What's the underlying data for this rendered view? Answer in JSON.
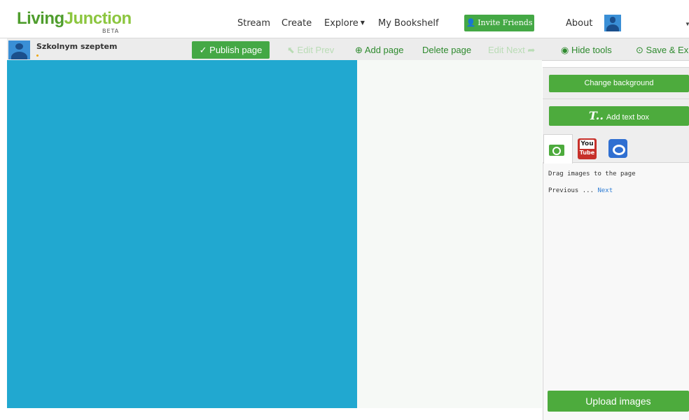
{
  "brand": {
    "name_part1": "Living",
    "name_part2": "Junction",
    "badge": "BETA"
  },
  "topnav": {
    "items": [
      "Stream",
      "Create",
      "Explore",
      "My Bookshelf"
    ],
    "invite_label": "Invite Friends",
    "about_label": "About"
  },
  "user": {
    "name": "Szkolnym szeptem"
  },
  "toolbar": {
    "publish_label": "✓ Publish page",
    "edit_prev_label": "Edit Prev",
    "add_page_label": "Add page",
    "delete_page_label": "Delete page",
    "edit_next_label": "Edit Next",
    "hide_tools_label": "Hide tools",
    "save_exit_label": "Save & Exi"
  },
  "sidebar": {
    "change_background_label": "Change background",
    "add_text_box_label": "Add text box",
    "add_text_icon_label": "T..",
    "tabs": [
      "camera",
      "youtube",
      "bing"
    ],
    "youtube_top": "You",
    "youtube_bottom": "Tube",
    "drag_hint": "Drag images to the page",
    "previous_label": "Previous ...",
    "next_label": "Next",
    "upload_label": "Upload images"
  },
  "colors": {
    "green": "#44a845",
    "canvas_blue": "#21a8d0",
    "link_blue": "#2b7bd4"
  }
}
